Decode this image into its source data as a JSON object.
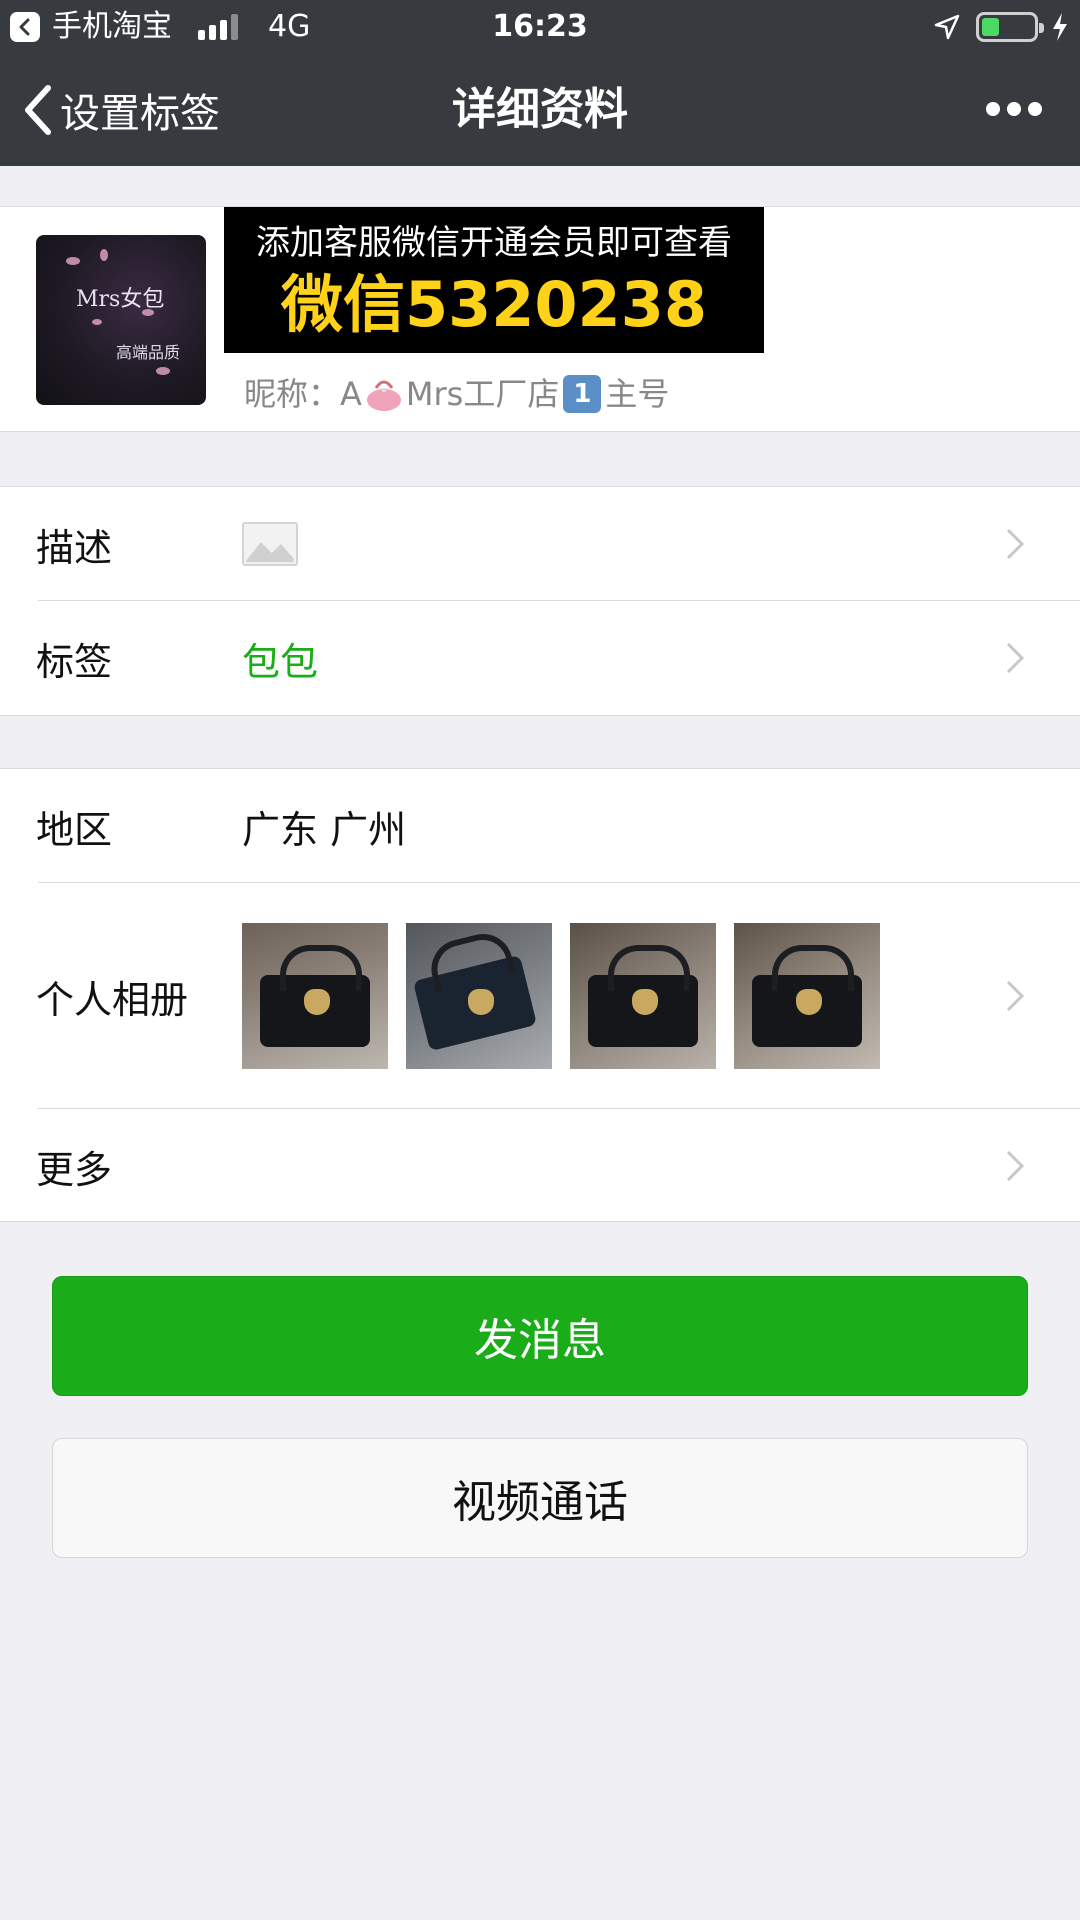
{
  "status_bar": {
    "app_name": "手机淘宝",
    "network": "4G",
    "time": "16:23",
    "battery_level": 0.25
  },
  "nav": {
    "back_label": "设置标签",
    "title": "详细资料"
  },
  "profile": {
    "avatar_brand": "Mrs女包",
    "avatar_sub": "高端品质",
    "promo_line1": "添加客服微信开通会员即可查看",
    "promo_line2": "微信5320238",
    "nick_prefix": "昵称：A",
    "nick_mid": "Mrs工厂店",
    "nick_badge": "1",
    "nick_suffix": "主号"
  },
  "rows": {
    "description_label": "描述",
    "tag_label": "标签",
    "tag_value": "包包",
    "region_label": "地区",
    "region_value": "广东  广州",
    "album_label": "个人相册",
    "more_label": "更多"
  },
  "buttons": {
    "send_message": "发消息",
    "video_call": "视频通话"
  },
  "colors": {
    "nav_bg": "#373a3f",
    "accent_green": "#1aad19",
    "tag_green": "#1aad19",
    "promo_yellow": "#ffd21a"
  }
}
